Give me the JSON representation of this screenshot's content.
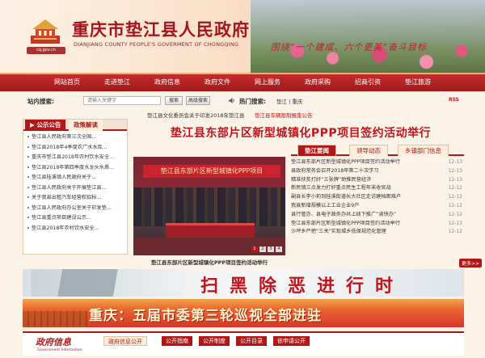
{
  "header": {
    "title": "重庆市垫江县人民政府",
    "subtitle": "DIANJIANG COUNTY PEOPLE'S GOVERMENT OF CHONGQING",
    "logo_url": "cq.gov.cn",
    "slogan": "围绕“一个建成、六个更美”奋斗目标"
  },
  "nav": {
    "items": [
      "网站首页",
      "走进垫江",
      "政府信息",
      "政府文件",
      "网上服务",
      "政府采购",
      "招商引资",
      "垫江旅游"
    ]
  },
  "search": {
    "label": "站内搜索:",
    "placeholder": "请输入关键字",
    "search_button": "搜索",
    "advanced_button": "高级搜索",
    "hot_label": "热门搜索:",
    "hot_words": "垫江 | 重庆",
    "rss": "RSS"
  },
  "ticker": {
    "item1": "垫江县文化委员会关于印发2018年垫江县",
    "item2": "垫江县车辆限制报废公告"
  },
  "left": {
    "tab_active": "公示公告",
    "tab_other": "政策解读",
    "items": [
      "垫江县人民政府第三次全国...",
      "垫江县2018年4季度农广水水库...",
      "重庆市垫江县2018年农村饮水安全...",
      "垫江县2018年第四季度水龙头水质...",
      "垫江县桂溪镇人民政府关于...",
      "垫江县人民政府关于开展垫江县...",
      "关于我县出租汽车经营权招标...",
      "垫江县人民政府办公室关于印发垫...",
      "垫江县重点项目建设公示...",
      "垫江县2018年农村饮水安全..."
    ]
  },
  "headline": "垫江县东部片区新型城镇化PPP项目签约活动举行",
  "photo": {
    "banner": "垫江县东部片区新型城镇化PPP项目",
    "caption": "垫江县东部片区新型城镇化PPP项目签约活动举行",
    "pager": [
      "1",
      "2",
      "3",
      "4"
    ]
  },
  "news": {
    "tabs": [
      "垫江要闻",
      "领导动态",
      "乡镇部门信息"
    ],
    "items": [
      {
        "title": "垫江县东部片区新型城镇化PPP项目签约活动举行",
        "date": "12-13"
      },
      {
        "title": "县政府常务会召开2018年第二十次学习",
        "date": "12-13"
      },
      {
        "title": "精准扶贫打好“三张牌”助推民营经济",
        "date": "12-13"
      },
      {
        "title": "新民镇三点发力打好重点民生工程年末收官战",
        "date": "12-12"
      },
      {
        "title": "副县长李小莉到桂溪街道长大社区走访建档困难户",
        "date": "12-12"
      },
      {
        "title": "我县新增规模以上工业企业9户",
        "date": "12-12"
      },
      {
        "title": "县行管办、县电子政务办共上线下推广“渝快办”",
        "date": "12-12"
      },
      {
        "title": "垫江县东部片区新型城镇化PPP项目签约活动举行",
        "date": "12-13"
      },
      {
        "title": "沙坪乡严把“三关”实现城乡低保规范化管理",
        "date": "12-12"
      }
    ],
    "more": "更多>>"
  },
  "banner1": {
    "text": "扫黑除恶进行时"
  },
  "banner2": {
    "text": "重庆：五届市委第三轮巡视全部进驻"
  },
  "info": {
    "title": "政府信息",
    "subtitle": "Government Information",
    "tabs": [
      "政府信息公开",
      "公开指南",
      "公开制度",
      "公开目录",
      "依申请公开"
    ]
  },
  "colors": {
    "primary": "#b01818",
    "headline": "#c0151c",
    "background": "#fbf3e8"
  }
}
